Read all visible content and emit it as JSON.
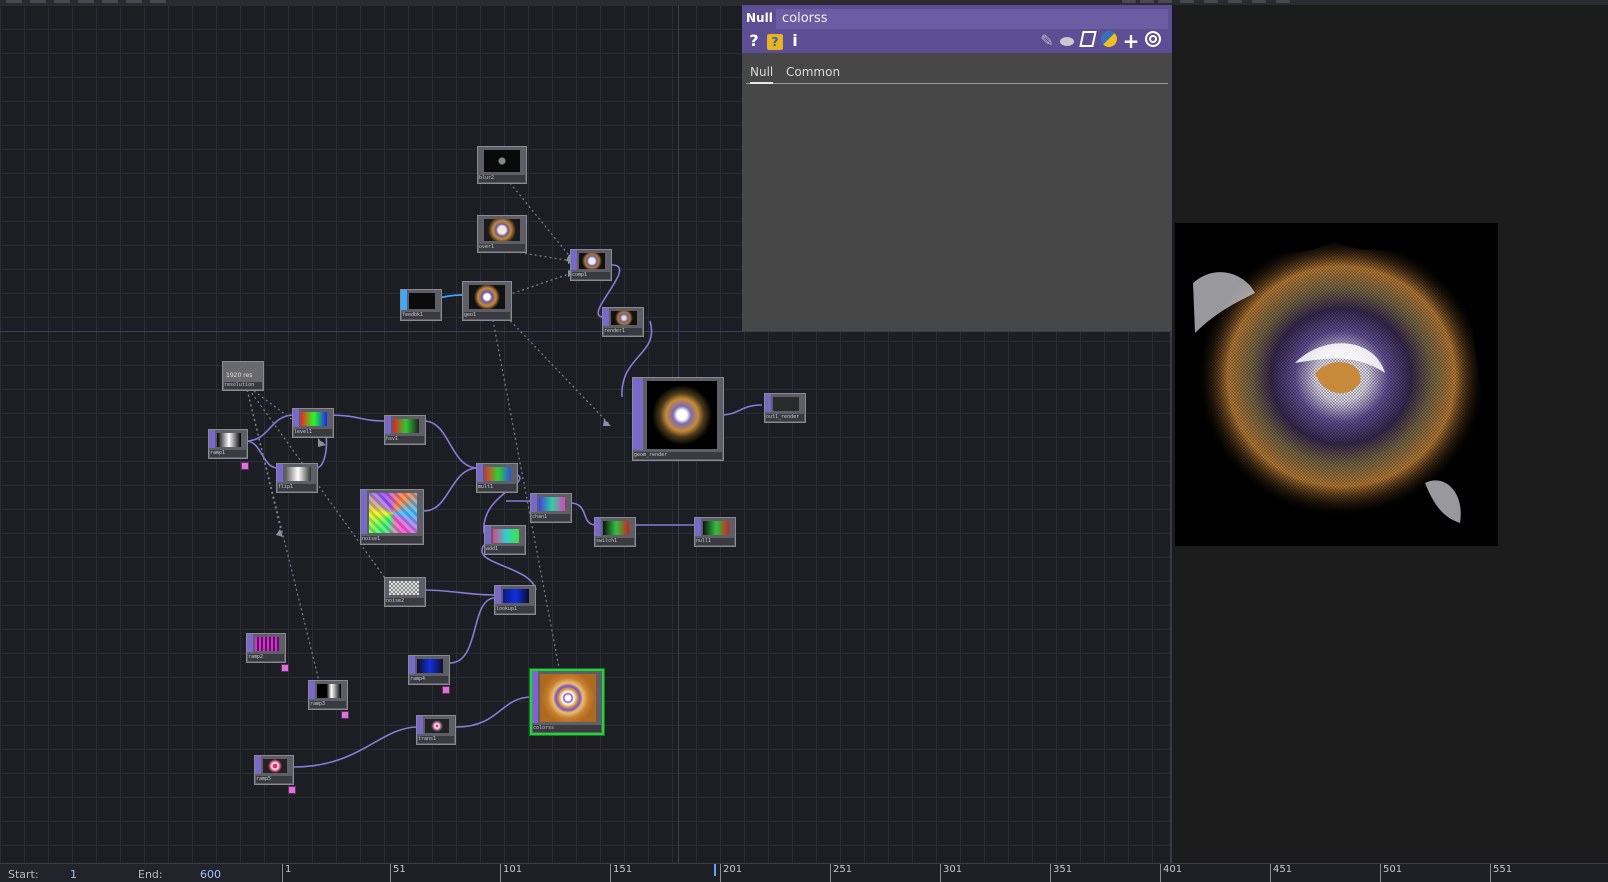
{
  "network": {
    "nodes": [
      {
        "key": "n_blur",
        "label": "blur2",
        "kind": "dark"
      },
      {
        "key": "n_over",
        "label": "over1",
        "kind": "fractal"
      },
      {
        "key": "n_comp",
        "label": "comp1",
        "kind": "fractal"
      },
      {
        "key": "n_feedbk",
        "label": "feedbk1",
        "kind": "dark"
      },
      {
        "key": "n_geo1",
        "label": "geo1",
        "kind": "fractal"
      },
      {
        "key": "n_render",
        "label": "render1",
        "kind": "fractal"
      },
      {
        "key": "n_geom",
        "label": "geom_render",
        "kind": "fractal"
      },
      {
        "key": "n_out",
        "label": "out1_render",
        "kind": "dark"
      },
      {
        "key": "n_res",
        "label": "resolution",
        "kind": "res"
      },
      {
        "key": "n_ramp1",
        "label": "ramp1",
        "kind": "ramp"
      },
      {
        "key": "n_lvl",
        "label": "level1",
        "kind": "rgb"
      },
      {
        "key": "n_hsv",
        "label": "hsv1",
        "kind": "rgb"
      },
      {
        "key": "n_flip",
        "label": "flip1",
        "kind": "ramp"
      },
      {
        "key": "n_noise",
        "label": "noise1",
        "kind": "noise"
      },
      {
        "key": "n_mult",
        "label": "mult1",
        "kind": "rgb"
      },
      {
        "key": "n_chan",
        "label": "chan1",
        "kind": "rgb"
      },
      {
        "key": "n_add",
        "label": "add1",
        "kind": "rgb"
      },
      {
        "key": "n_sw",
        "label": "switch1",
        "kind": "green"
      },
      {
        "key": "n_null",
        "label": "null1",
        "kind": "green"
      },
      {
        "key": "n_noise2",
        "label": "noise2",
        "kind": "smallnoise"
      },
      {
        "key": "n_lookup",
        "label": "lookup1",
        "kind": "blue"
      },
      {
        "key": "n_ramp2",
        "label": "ramp2",
        "kind": "pink"
      },
      {
        "key": "n_ramp3",
        "label": "ramp3",
        "kind": "ramp"
      },
      {
        "key": "n_ramp4",
        "label": "ramp4",
        "kind": "blue"
      },
      {
        "key": "n_ramp5",
        "label": "ramp5",
        "kind": "target"
      },
      {
        "key": "n_trans",
        "label": "trans1",
        "kind": "target"
      },
      {
        "key": "n_colorss",
        "label": "colorss",
        "kind": "rings"
      }
    ],
    "resolution_text": "1920 res"
  },
  "params": {
    "op_type": "Null",
    "op_name": "colorss",
    "icons": [
      "help-icon",
      "python-help-icon",
      "info-icon",
      "edit-icon",
      "comment-icon",
      "clone-icon",
      "python-icon",
      "add-icon",
      "target-icon"
    ],
    "tabs": [
      {
        "label": "Null",
        "active": true
      },
      {
        "label": "Common",
        "active": false
      }
    ]
  },
  "timeline": {
    "start_label": "Start:",
    "start_value": "1",
    "end_label": "End:",
    "end_value": "600",
    "ticks": [
      "1",
      "51",
      "101",
      "151",
      "201",
      "251",
      "301",
      "351",
      "401",
      "451",
      "501",
      "551"
    ]
  },
  "colors": {
    "accent": "#7a68c8",
    "selected": "#22d33a",
    "param_header": "#5b4e92",
    "wire": "#8a7ad8"
  }
}
